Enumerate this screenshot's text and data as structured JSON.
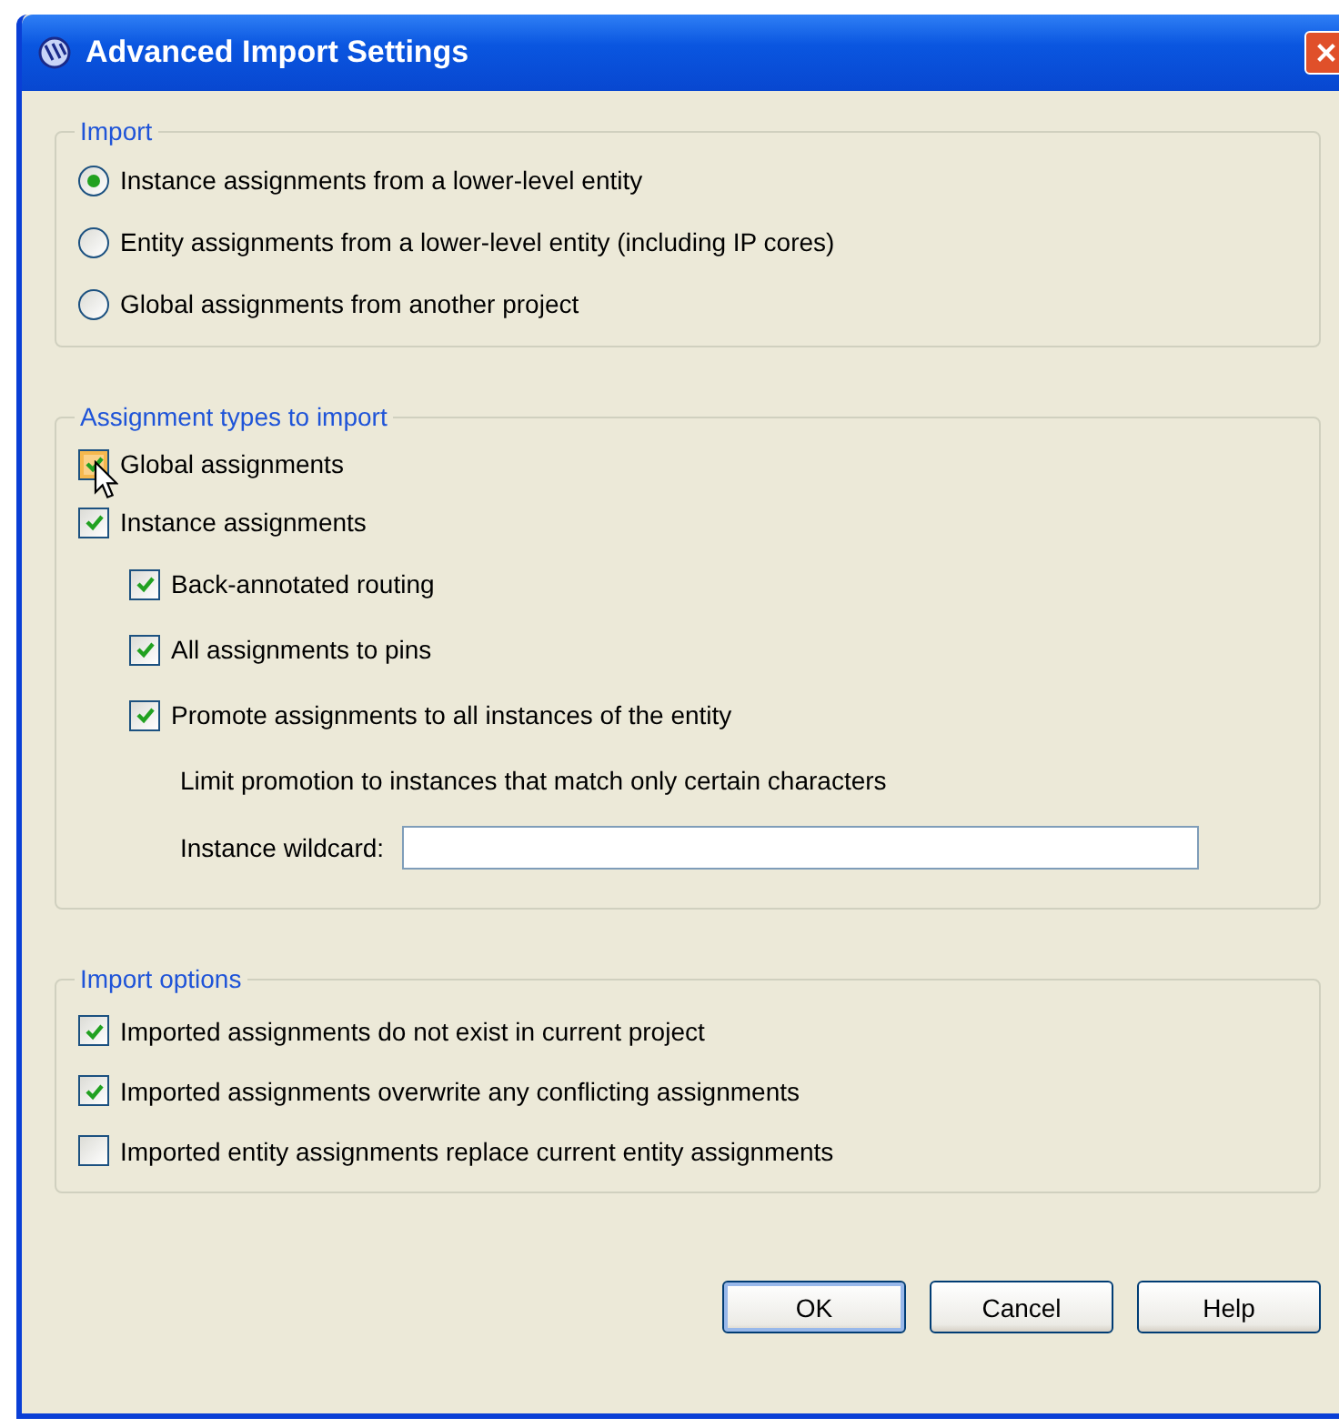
{
  "window": {
    "title": "Advanced Import Settings"
  },
  "import": {
    "legend": "Import",
    "options": [
      {
        "label": "Instance assignments from a lower-level entity",
        "selected": true
      },
      {
        "label": "Entity assignments from a lower-level entity (including IP cores)",
        "selected": false
      },
      {
        "label": "Global assignments from another project",
        "selected": false
      }
    ]
  },
  "assignment_types": {
    "legend": "Assignment types to import",
    "items": [
      {
        "label": "Global assignments",
        "checked": true,
        "hover": true
      },
      {
        "label": "Instance assignments",
        "checked": true,
        "hover": false,
        "children": [
          {
            "label": "Back-annotated routing",
            "checked": true,
            "hover": false
          },
          {
            "label": "All assignments to pins",
            "checked": true,
            "hover": false
          },
          {
            "label": "Promote assignments to all instances of the entity",
            "checked": true,
            "hover": false
          }
        ]
      }
    ],
    "note": "Limit promotion to instances that match only certain characters",
    "wildcard": {
      "label": "Instance wildcard:"
    }
  },
  "import_options": {
    "legend": "Import options",
    "items": [
      {
        "label": "Imported assignments do not exist in current project",
        "checked": true
      },
      {
        "label": "Imported assignments overwrite any conflicting assignments",
        "checked": true
      },
      {
        "label": "Imported entity assignments replace current entity assignments",
        "checked": false
      }
    ]
  },
  "buttons": [
    {
      "label": "OK",
      "default": true
    },
    {
      "label": "Cancel",
      "default": false
    },
    {
      "label": "Help",
      "default": false
    }
  ]
}
